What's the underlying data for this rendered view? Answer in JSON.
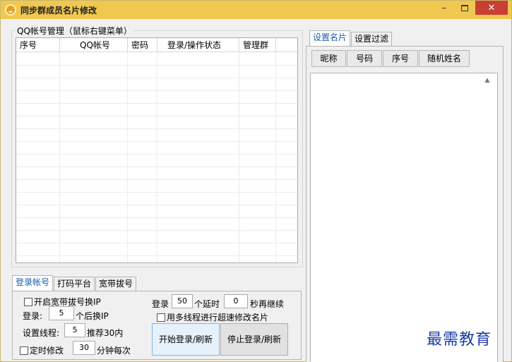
{
  "window": {
    "title": "同步群成员名片修改",
    "minimize_label": "–",
    "close_label": "✕",
    "icon": "app-logo-icon"
  },
  "account_group": {
    "title": "QQ帐号管理（鼠标右键菜单）",
    "columns": [
      "序号",
      "QQ帐号",
      "密码",
      "登录/操作状态",
      "管理群"
    ]
  },
  "bottom_tabs": [
    "登录帐号",
    "打码平台",
    "宽带拔号"
  ],
  "login_panel": {
    "broadband_checkbox": "开启宽带拔号换IP",
    "login_prefix": "登录:",
    "login_count": "5",
    "login_suffix": "个后换IP",
    "threads_prefix": "设置线程:",
    "threads_value": "5",
    "threads_suffix": "推荐30内",
    "timed_checkbox": "定时修改",
    "timed_value": "30",
    "timed_suffix": "分钟每次",
    "batch_prefix": "登录",
    "batch_value": "50",
    "delay_prefix": "个延时",
    "delay_value": "0",
    "delay_suffix": "秒再继续",
    "multithread_checkbox": "用多线程进行超速修改名片",
    "start_button": "开始登录/刷新",
    "stop_button": "停止登录/刷新"
  },
  "right_tabs": [
    "设置名片",
    "设置过滤"
  ],
  "card_buttons": [
    "昵称",
    "号码",
    "序号",
    "随机姓名"
  ],
  "watermark": "最需教育"
}
